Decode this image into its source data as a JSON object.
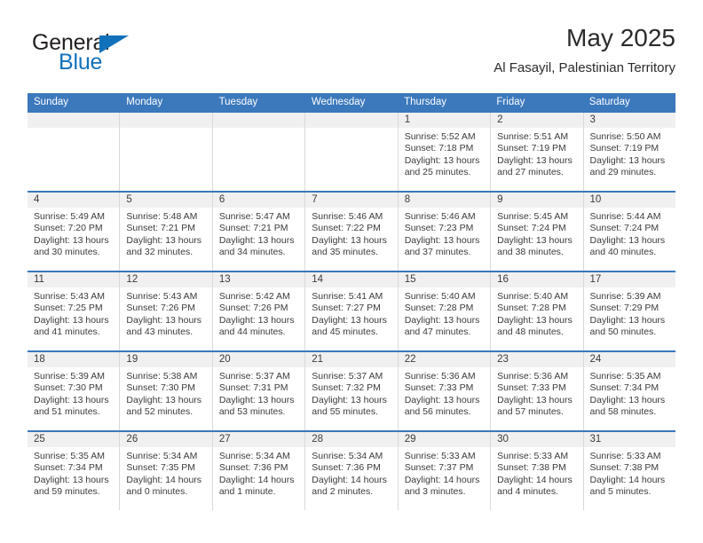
{
  "brand": {
    "name_top": "General",
    "name_bottom": "Blue",
    "accent_color": "#1271bb",
    "triangle_icon": "brand-triangle-icon"
  },
  "header": {
    "title": "May 2025",
    "subtitle": "Al Fasayil, Palestinian Territory"
  },
  "colors": {
    "header_blue": "#3b78bc",
    "daynum_band": "#f0f0f0",
    "text": "#3b3b3b"
  },
  "weekdays": [
    "Sunday",
    "Monday",
    "Tuesday",
    "Wednesday",
    "Thursday",
    "Friday",
    "Saturday"
  ],
  "labels": {
    "sunrise": "Sunrise:",
    "sunset": "Sunset:",
    "daylight": "Daylight:"
  },
  "weeks": [
    [
      {
        "day": "",
        "empty": true
      },
      {
        "day": "",
        "empty": true
      },
      {
        "day": "",
        "empty": true
      },
      {
        "day": "",
        "empty": true
      },
      {
        "day": "1",
        "sunrise": "Sunrise: 5:52 AM",
        "sunset": "Sunset: 7:18 PM",
        "daylight": "Daylight: 13 hours and 25 minutes."
      },
      {
        "day": "2",
        "sunrise": "Sunrise: 5:51 AM",
        "sunset": "Sunset: 7:19 PM",
        "daylight": "Daylight: 13 hours and 27 minutes."
      },
      {
        "day": "3",
        "sunrise": "Sunrise: 5:50 AM",
        "sunset": "Sunset: 7:19 PM",
        "daylight": "Daylight: 13 hours and 29 minutes."
      }
    ],
    [
      {
        "day": "4",
        "sunrise": "Sunrise: 5:49 AM",
        "sunset": "Sunset: 7:20 PM",
        "daylight": "Daylight: 13 hours and 30 minutes."
      },
      {
        "day": "5",
        "sunrise": "Sunrise: 5:48 AM",
        "sunset": "Sunset: 7:21 PM",
        "daylight": "Daylight: 13 hours and 32 minutes."
      },
      {
        "day": "6",
        "sunrise": "Sunrise: 5:47 AM",
        "sunset": "Sunset: 7:21 PM",
        "daylight": "Daylight: 13 hours and 34 minutes."
      },
      {
        "day": "7",
        "sunrise": "Sunrise: 5:46 AM",
        "sunset": "Sunset: 7:22 PM",
        "daylight": "Daylight: 13 hours and 35 minutes."
      },
      {
        "day": "8",
        "sunrise": "Sunrise: 5:46 AM",
        "sunset": "Sunset: 7:23 PM",
        "daylight": "Daylight: 13 hours and 37 minutes."
      },
      {
        "day": "9",
        "sunrise": "Sunrise: 5:45 AM",
        "sunset": "Sunset: 7:24 PM",
        "daylight": "Daylight: 13 hours and 38 minutes."
      },
      {
        "day": "10",
        "sunrise": "Sunrise: 5:44 AM",
        "sunset": "Sunset: 7:24 PM",
        "daylight": "Daylight: 13 hours and 40 minutes."
      }
    ],
    [
      {
        "day": "11",
        "sunrise": "Sunrise: 5:43 AM",
        "sunset": "Sunset: 7:25 PM",
        "daylight": "Daylight: 13 hours and 41 minutes."
      },
      {
        "day": "12",
        "sunrise": "Sunrise: 5:43 AM",
        "sunset": "Sunset: 7:26 PM",
        "daylight": "Daylight: 13 hours and 43 minutes."
      },
      {
        "day": "13",
        "sunrise": "Sunrise: 5:42 AM",
        "sunset": "Sunset: 7:26 PM",
        "daylight": "Daylight: 13 hours and 44 minutes."
      },
      {
        "day": "14",
        "sunrise": "Sunrise: 5:41 AM",
        "sunset": "Sunset: 7:27 PM",
        "daylight": "Daylight: 13 hours and 45 minutes."
      },
      {
        "day": "15",
        "sunrise": "Sunrise: 5:40 AM",
        "sunset": "Sunset: 7:28 PM",
        "daylight": "Daylight: 13 hours and 47 minutes."
      },
      {
        "day": "16",
        "sunrise": "Sunrise: 5:40 AM",
        "sunset": "Sunset: 7:28 PM",
        "daylight": "Daylight: 13 hours and 48 minutes."
      },
      {
        "day": "17",
        "sunrise": "Sunrise: 5:39 AM",
        "sunset": "Sunset: 7:29 PM",
        "daylight": "Daylight: 13 hours and 50 minutes."
      }
    ],
    [
      {
        "day": "18",
        "sunrise": "Sunrise: 5:39 AM",
        "sunset": "Sunset: 7:30 PM",
        "daylight": "Daylight: 13 hours and 51 minutes."
      },
      {
        "day": "19",
        "sunrise": "Sunrise: 5:38 AM",
        "sunset": "Sunset: 7:30 PM",
        "daylight": "Daylight: 13 hours and 52 minutes."
      },
      {
        "day": "20",
        "sunrise": "Sunrise: 5:37 AM",
        "sunset": "Sunset: 7:31 PM",
        "daylight": "Daylight: 13 hours and 53 minutes."
      },
      {
        "day": "21",
        "sunrise": "Sunrise: 5:37 AM",
        "sunset": "Sunset: 7:32 PM",
        "daylight": "Daylight: 13 hours and 55 minutes."
      },
      {
        "day": "22",
        "sunrise": "Sunrise: 5:36 AM",
        "sunset": "Sunset: 7:33 PM",
        "daylight": "Daylight: 13 hours and 56 minutes."
      },
      {
        "day": "23",
        "sunrise": "Sunrise: 5:36 AM",
        "sunset": "Sunset: 7:33 PM",
        "daylight": "Daylight: 13 hours and 57 minutes."
      },
      {
        "day": "24",
        "sunrise": "Sunrise: 5:35 AM",
        "sunset": "Sunset: 7:34 PM",
        "daylight": "Daylight: 13 hours and 58 minutes."
      }
    ],
    [
      {
        "day": "25",
        "sunrise": "Sunrise: 5:35 AM",
        "sunset": "Sunset: 7:34 PM",
        "daylight": "Daylight: 13 hours and 59 minutes."
      },
      {
        "day": "26",
        "sunrise": "Sunrise: 5:34 AM",
        "sunset": "Sunset: 7:35 PM",
        "daylight": "Daylight: 14 hours and 0 minutes."
      },
      {
        "day": "27",
        "sunrise": "Sunrise: 5:34 AM",
        "sunset": "Sunset: 7:36 PM",
        "daylight": "Daylight: 14 hours and 1 minute."
      },
      {
        "day": "28",
        "sunrise": "Sunrise: 5:34 AM",
        "sunset": "Sunset: 7:36 PM",
        "daylight": "Daylight: 14 hours and 2 minutes."
      },
      {
        "day": "29",
        "sunrise": "Sunrise: 5:33 AM",
        "sunset": "Sunset: 7:37 PM",
        "daylight": "Daylight: 14 hours and 3 minutes."
      },
      {
        "day": "30",
        "sunrise": "Sunrise: 5:33 AM",
        "sunset": "Sunset: 7:38 PM",
        "daylight": "Daylight: 14 hours and 4 minutes."
      },
      {
        "day": "31",
        "sunrise": "Sunrise: 5:33 AM",
        "sunset": "Sunset: 7:38 PM",
        "daylight": "Daylight: 14 hours and 5 minutes."
      }
    ]
  ]
}
